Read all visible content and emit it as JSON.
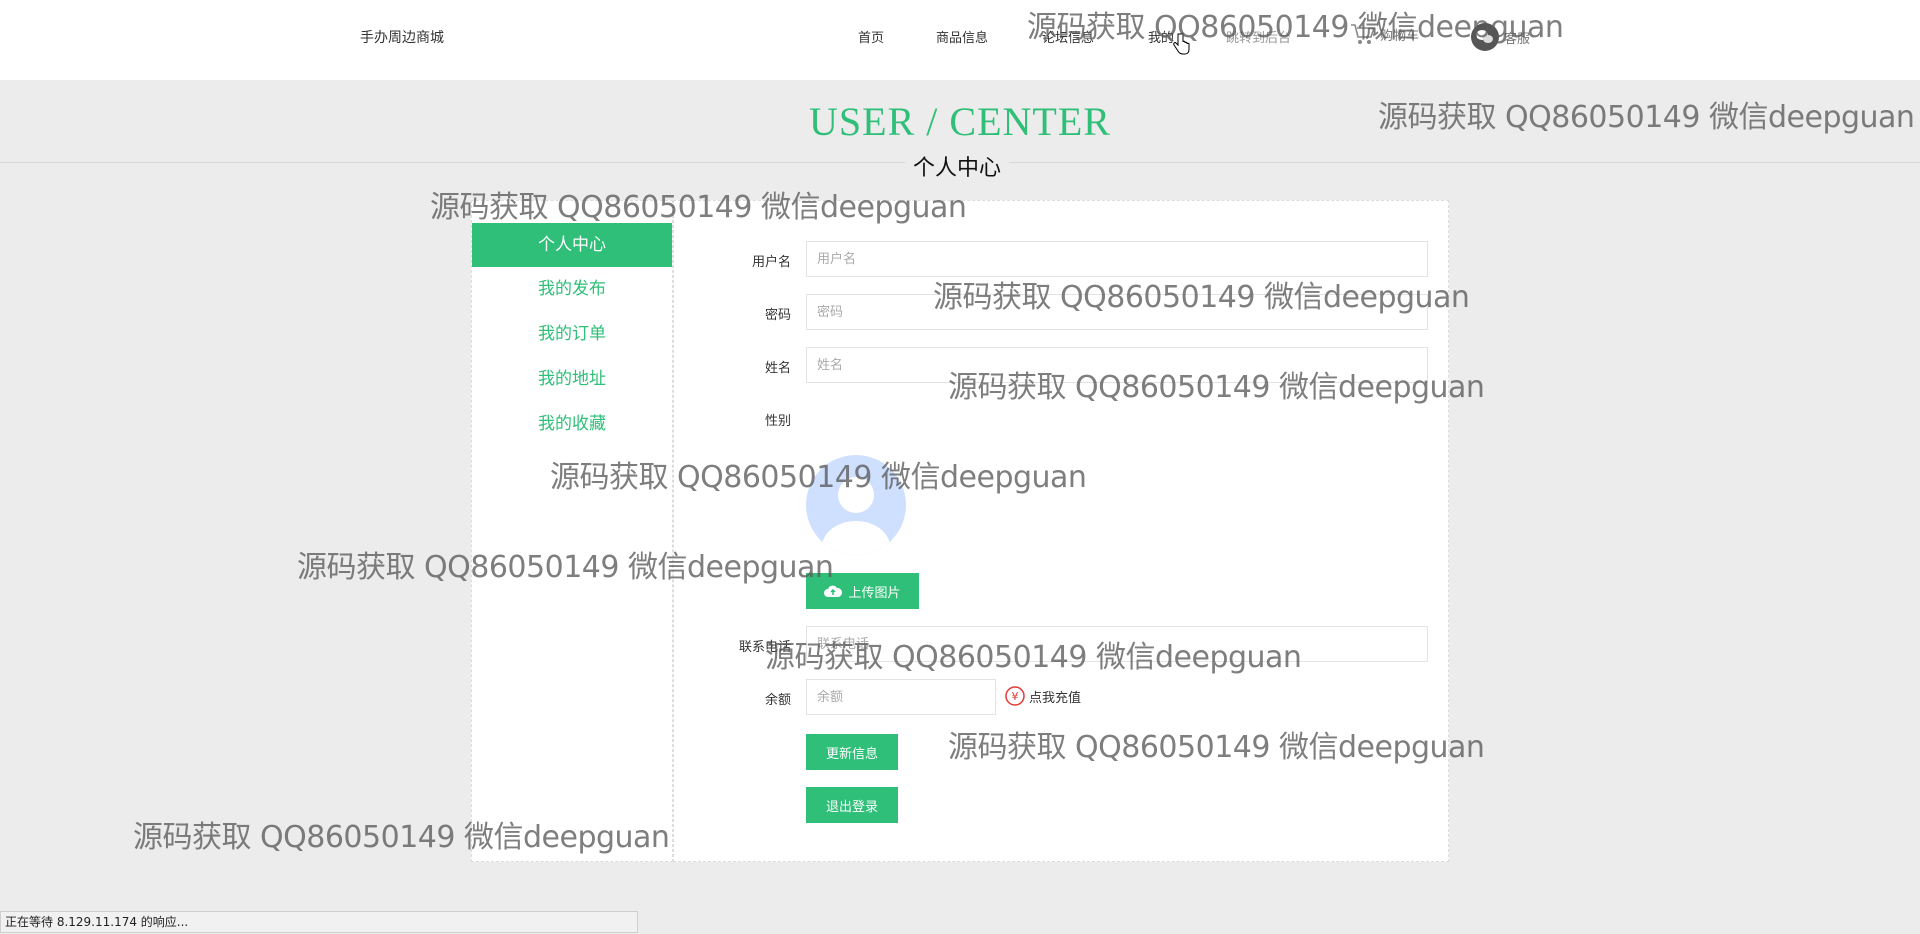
{
  "nav": {
    "brand": "手办周边商城",
    "items": [
      "首页",
      "商品信息",
      "论坛信息",
      "我的",
      "跳转到后台"
    ],
    "cart": "购物车",
    "service": "客服"
  },
  "header": {
    "title": "USER / CENTER",
    "subtitle": "个人中心"
  },
  "sidebar": {
    "items": [
      "个人中心",
      "我的发布",
      "我的订单",
      "我的地址",
      "我的收藏"
    ]
  },
  "form": {
    "username_label": "用户名",
    "username_placeholder": "用户名",
    "password_label": "密码",
    "password_placeholder": "密码",
    "name_label": "姓名",
    "name_placeholder": "姓名",
    "gender_label": "性别",
    "upload_button": "上传图片",
    "phone_label": "联系电话",
    "phone_placeholder": "联系电话",
    "balance_label": "余额",
    "balance_placeholder": "余额",
    "recharge_link": "点我充值",
    "update_button": "更新信息",
    "logout_button": "退出登录"
  },
  "watermark": "源码获取 QQ86050149 微信deepguan",
  "status_bar": "正在等待 8.129.11.174 的响应...",
  "colors": {
    "accent": "#2fbf78",
    "page_bg": "#ececec",
    "recharge_icon": "#e53935"
  }
}
